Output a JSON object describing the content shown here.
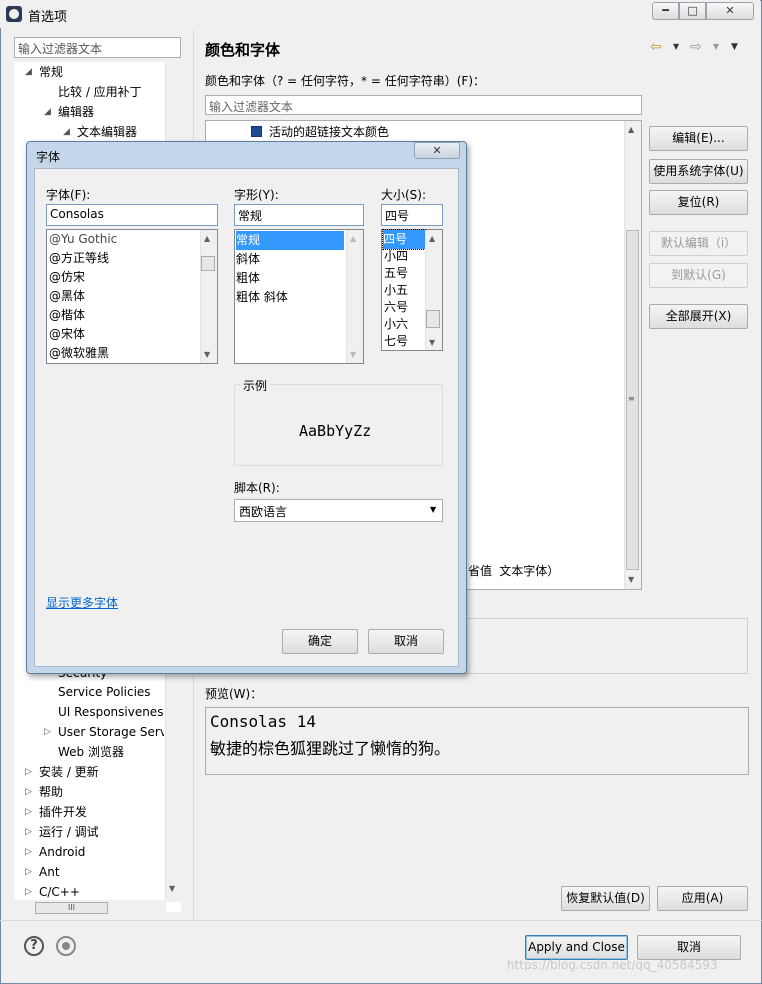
{
  "window": {
    "title": "首选项"
  },
  "sidebar": {
    "filter_placeholder": "输入过滤器文本",
    "items": [
      {
        "label": "常规",
        "twisty": "◢"
      },
      {
        "label": "比较 / 应用补丁",
        "twisty": ""
      },
      {
        "label": "编辑器",
        "twisty": "◢"
      },
      {
        "label": "文本编辑器",
        "twisty": "◢"
      },
      {
        "label": "Security",
        "twisty": ""
      },
      {
        "label": "Service Policies",
        "twisty": ""
      },
      {
        "label": "UI Responsiveness",
        "twisty": ""
      },
      {
        "label": "User Storage Service",
        "twisty": "▷"
      },
      {
        "label": "Web 浏览器",
        "twisty": ""
      },
      {
        "label": "安装 / 更新",
        "twisty": "▷"
      },
      {
        "label": "帮助",
        "twisty": "▷"
      },
      {
        "label": "插件开发",
        "twisty": "▷"
      },
      {
        "label": "运行 / 调试",
        "twisty": "▷"
      },
      {
        "label": "Android",
        "twisty": "▷"
      },
      {
        "label": "Ant",
        "twisty": "▷"
      },
      {
        "label": "C/C++",
        "twisty": "▷"
      }
    ],
    "hscroll_grip": "III"
  },
  "main": {
    "title": "颜色和字体",
    "description": "颜色和字体（? = 任何字符，* = 任何字符串）(F)：",
    "filter_placeholder": "输入过滤器文本",
    "tree_item": "活动的超链接文本颜色",
    "tree_truncated_text": "省值 文本字体）",
    "buttons": {
      "edit": "编辑(E)...",
      "use_system_font": "使用系统字体(U)",
      "reset": "复位(R)",
      "edit_default": "默认编辑（i）",
      "goto_default": "到默认(G)",
      "expand_all": "全部展开(X)"
    },
    "preview_label": "预览(W)：",
    "preview_line1": "Consolas 14",
    "preview_line2": "敏捷的棕色狐狸跳过了懒惰的狗。",
    "restore_defaults": "恢复默认值(D)",
    "apply": "应用(A)"
  },
  "footer": {
    "apply_and_close": "Apply and Close",
    "cancel": "取消",
    "help_glyph": "?",
    "watermark": "https://blog.csdn.net/qq_40584593"
  },
  "font_dialog": {
    "title": "字体",
    "close_glyph": "✕",
    "font_label": "字体(F):",
    "font_value": "Consolas",
    "font_list": [
      "@Yu Gothic",
      "@方正等线",
      "@仿宋",
      "@黑体",
      "@楷体",
      "@宋体",
      "@微软雅黑"
    ],
    "style_label": "字形(Y):",
    "style_value": "常规",
    "style_list": [
      "常规",
      "斜体",
      "粗体",
      "粗体 斜体"
    ],
    "size_label": "大小(S):",
    "size_value": "四号",
    "size_list": [
      "四号",
      "小四",
      "五号",
      "小五",
      "六号",
      "小六",
      "七号"
    ],
    "sample_label": "示例",
    "sample_text": "AaBbYyZz",
    "script_label": "脚本(R):",
    "script_value": "西欧语言",
    "more_fonts": "显示更多字体",
    "ok": "确定",
    "cancel": "取消"
  },
  "icons": {
    "nav_back": "⇦",
    "nav_forward": "⇨",
    "dropdown": "▼",
    "scroll_up": "▲",
    "scroll_down": "▼",
    "scroll_grip": "≡",
    "min": "━",
    "max": "□",
    "close": "✕"
  }
}
